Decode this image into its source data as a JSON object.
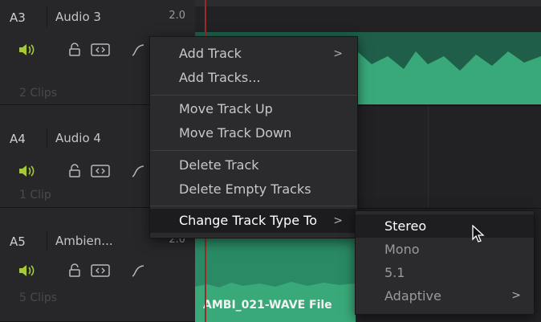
{
  "tracks": [
    {
      "id": "A3",
      "name": "Audio 3",
      "type": "2.0",
      "clips": "2 Clips"
    },
    {
      "id": "A4",
      "name": "Audio 4",
      "type": "",
      "clips": "1 Clip"
    },
    {
      "id": "A5",
      "name": "Ambien...",
      "type": "2.0",
      "clips": "5 Clips"
    }
  ],
  "clip": {
    "name": "AMBI_021-WAVE File"
  },
  "context_menu": {
    "items": [
      {
        "label": "Add Track",
        "arrow": ">"
      },
      {
        "label": "Add Tracks..."
      },
      {
        "label": "Move Track Up"
      },
      {
        "label": "Move Track Down"
      },
      {
        "label": "Delete Track"
      },
      {
        "label": "Delete Empty Tracks"
      },
      {
        "label": "Change Track Type To",
        "arrow": ">"
      }
    ]
  },
  "submenu": {
    "items": [
      {
        "label": "Stereo"
      },
      {
        "label": "Mono"
      },
      {
        "label": "5.1"
      },
      {
        "label": "Adaptive",
        "arrow": ">"
      }
    ]
  },
  "colors": {
    "waveform": "#3aa97a",
    "speaker_icon": "#a6c93a",
    "playhead": "#9b2b2b"
  }
}
